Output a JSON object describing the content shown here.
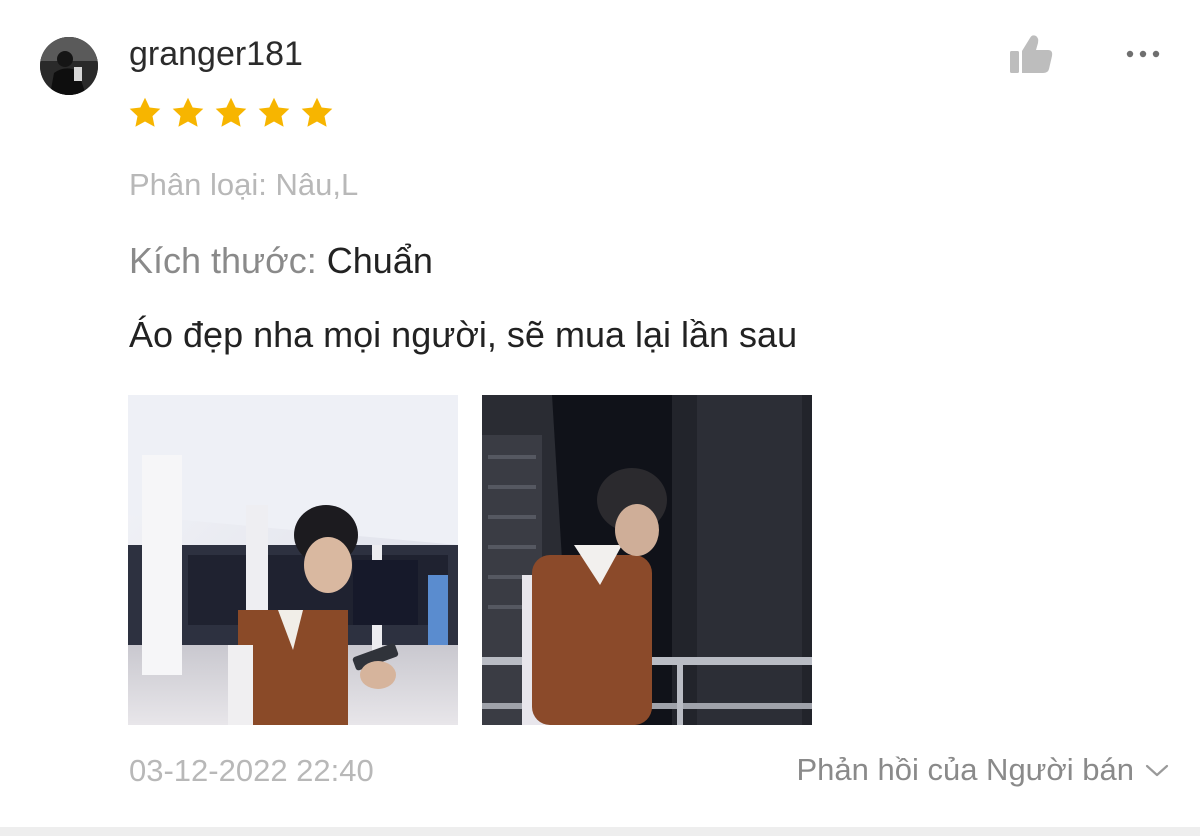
{
  "review": {
    "username": "granger181",
    "rating": 5,
    "max_rating": 5,
    "star_color": "#f7b500",
    "variation": "Phân loại: Nâu,L",
    "size_label": "Kích thước: ",
    "size_value": "Chuẩn",
    "comment": "Áo đẹp nha mọi người, sẽ mua lại lần sau",
    "timestamp": "03-12-2022 22:40",
    "seller_reply_label": "Phản hồi của Người bán"
  },
  "icons": {
    "like": "thumbs-up-icon",
    "more": "more-options-icon",
    "expand": "chevron-down-icon"
  }
}
